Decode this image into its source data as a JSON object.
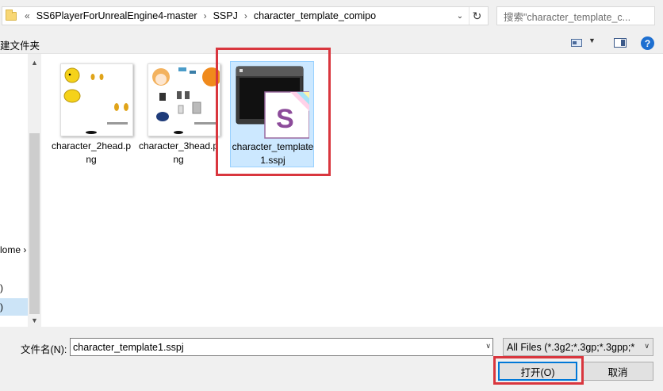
{
  "address": {
    "prefix": "«",
    "crumbs": [
      "SS6PlayerForUnrealEngine4-master",
      "SSPJ",
      "character_template_comipo"
    ],
    "separator": "›",
    "refresh": "↻",
    "dropdown": "⌄"
  },
  "search": {
    "placeholder": "搜索\"character_template_c..."
  },
  "toolbar": {
    "new_folder": "建文件夹",
    "help": "?"
  },
  "nav": {
    "items": [
      {
        "label": "lome ›"
      },
      {
        "label": ")"
      },
      {
        "label": ")"
      }
    ]
  },
  "files": [
    {
      "name": "character_2head.png",
      "icon": "image-thumbnail-icon"
    },
    {
      "name": "character_3head.png",
      "icon": "image-thumbnail-icon"
    },
    {
      "name": "character_template1.sspj",
      "icon": "sspj-file-icon",
      "selected": true,
      "thumb_letter": "S"
    }
  ],
  "bottom": {
    "filename_label": "文件名(N):",
    "filename_value": "character_template1.sspj",
    "filter_value": "All Files (*.3g2;*.3gp;*.3gpp;*",
    "open_button": "打开(O)",
    "cancel_button": "取消"
  },
  "colors": {
    "selection": "#cce8ff",
    "highlight_border": "#d9363e",
    "accent": "#0078d7"
  }
}
